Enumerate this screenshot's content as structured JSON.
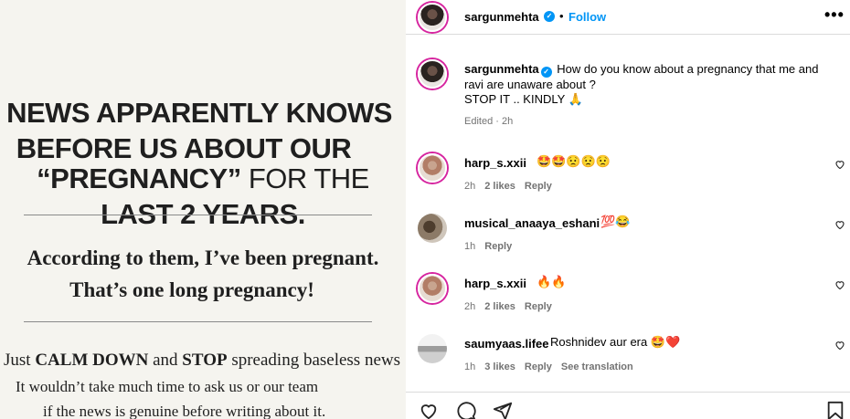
{
  "post_image": {
    "headline_line1": "NEWS APPARENTLY KNOWS",
    "headline_line2": "BEFORE US ABOUT OUR",
    "headline_line3_bold_a": "“PREGNANCY”",
    "headline_line3_light": " FOR THE ",
    "headline_line3_bold_b": "LAST 2 YEARS.",
    "serif_line1": "According to them, I’ve been pregnant.",
    "serif_line2": "That’s one long pregnancy!",
    "calm_a": "Just ",
    "calm_b": "CALM DOWN",
    "calm_c": " and ",
    "calm_d": "STOP",
    "calm_e": " spreading baseless news",
    "small_line1": "It wouldn’t take much time to ask us or our team",
    "small_line2": "if the news is genuine before writing about it."
  },
  "header": {
    "username": "sargunmehta",
    "dot": "•",
    "follow_label": "Follow",
    "more_icon": "•••"
  },
  "caption": {
    "username": "sargunmehta",
    "text_line1": " How do you know about a pregnancy that me and ravi are unaware about ?",
    "text_line2": "STOP IT .. KINDLY 🙏",
    "meta": "Edited · 2h"
  },
  "comments": [
    {
      "username": "harp_s.xxii",
      "text": "🤩🤩😟😟😟",
      "time": "2h",
      "likes": "2 likes",
      "reply": "Reply",
      "extra": ""
    },
    {
      "username": "musical_anaaya_eshani",
      "text": "💯😂",
      "time": "1h",
      "likes": "",
      "reply": "Reply",
      "extra": ""
    },
    {
      "username": "harp_s.xxii",
      "text": "🔥🔥",
      "time": "2h",
      "likes": "2 likes",
      "reply": "Reply",
      "extra": ""
    },
    {
      "username": "saumyaas.lifee",
      "text": "Roshnidev aur era 🤩❤️",
      "time": "1h",
      "likes": "3 likes",
      "reply": "Reply",
      "extra": "See translation"
    }
  ],
  "colors": {
    "accent": "#0095f6",
    "muted": "#737373",
    "border": "#dbdbdb",
    "story_ring": "#d6249f"
  },
  "icons": [
    "verified-badge-icon",
    "more-options-icon",
    "heart-icon",
    "comment-icon",
    "share-icon",
    "bookmark-icon"
  ]
}
